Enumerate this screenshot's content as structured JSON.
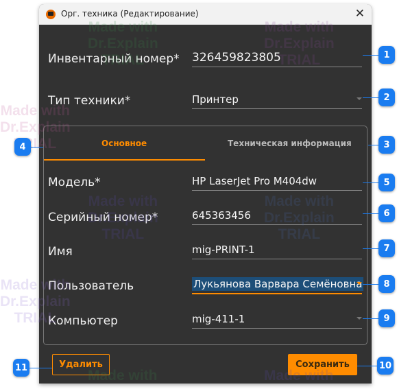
{
  "window": {
    "title": "Орг. техника (Редактирование)",
    "close_icon": "close-icon"
  },
  "fields": {
    "inventory": {
      "label": "Инвентарный номер*",
      "value": "326459823805"
    },
    "type": {
      "label": "Тип техники*",
      "value": "Принтер"
    },
    "model": {
      "label": "Модель*",
      "value": "HP LaserJet Pro M404dw"
    },
    "serial": {
      "label": "Серийный номер*",
      "value": "645363456"
    },
    "name": {
      "label": "Имя",
      "value": "mig-PRINT-1"
    },
    "user": {
      "label": "Пользователь",
      "value": "Лукьянова Варвара Семёновна"
    },
    "computer": {
      "label": "Компьютер",
      "value": "mig-411-1"
    }
  },
  "tabs": [
    {
      "label": "Основное",
      "active": true
    },
    {
      "label": "Техническая информация",
      "active": false
    }
  ],
  "buttons": {
    "delete": "Удалить",
    "save": "Сохранить"
  },
  "callouts": [
    "1",
    "2",
    "3",
    "4",
    "5",
    "6",
    "7",
    "8",
    "9",
    "10",
    "11"
  ],
  "watermark": {
    "line1": "Made with",
    "line2": "Dr.Explain",
    "line3": "TRIAL"
  },
  "colors": {
    "accent": "#ff8c00",
    "callout": "#1a7cf0",
    "background": "#323232"
  }
}
